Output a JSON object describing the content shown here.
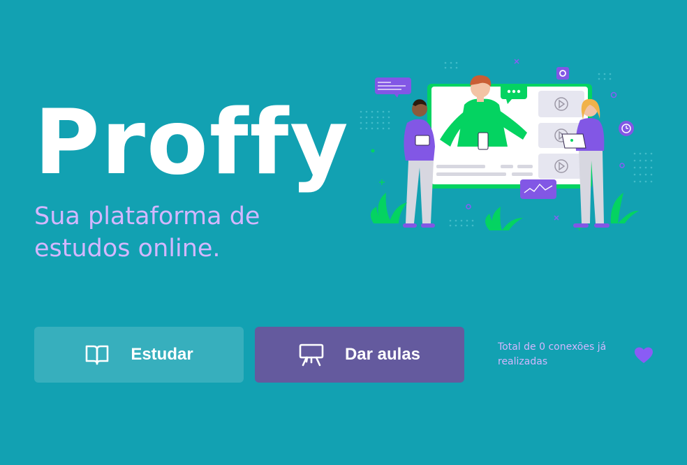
{
  "brand": {
    "logo_text": "Proffy",
    "tagline": "Sua plataforma de estudos online."
  },
  "buttons": {
    "study_label": "Estudar",
    "teach_label": "Dar aulas"
  },
  "stats": {
    "connections_text": "Total de 0 conexões já realizadas",
    "connections_count": 0
  },
  "colors": {
    "background": "#12A1B2",
    "tagline": "#D3B7FF",
    "study_button": "#37AFBD",
    "teach_button": "#645A9E",
    "heart": "#8A5CF5",
    "accent_green": "#04D361",
    "accent_purple": "#8257E5"
  },
  "icons": {
    "study": "book-open-icon",
    "teach": "presentation-icon",
    "connections": "heart-icon"
  }
}
